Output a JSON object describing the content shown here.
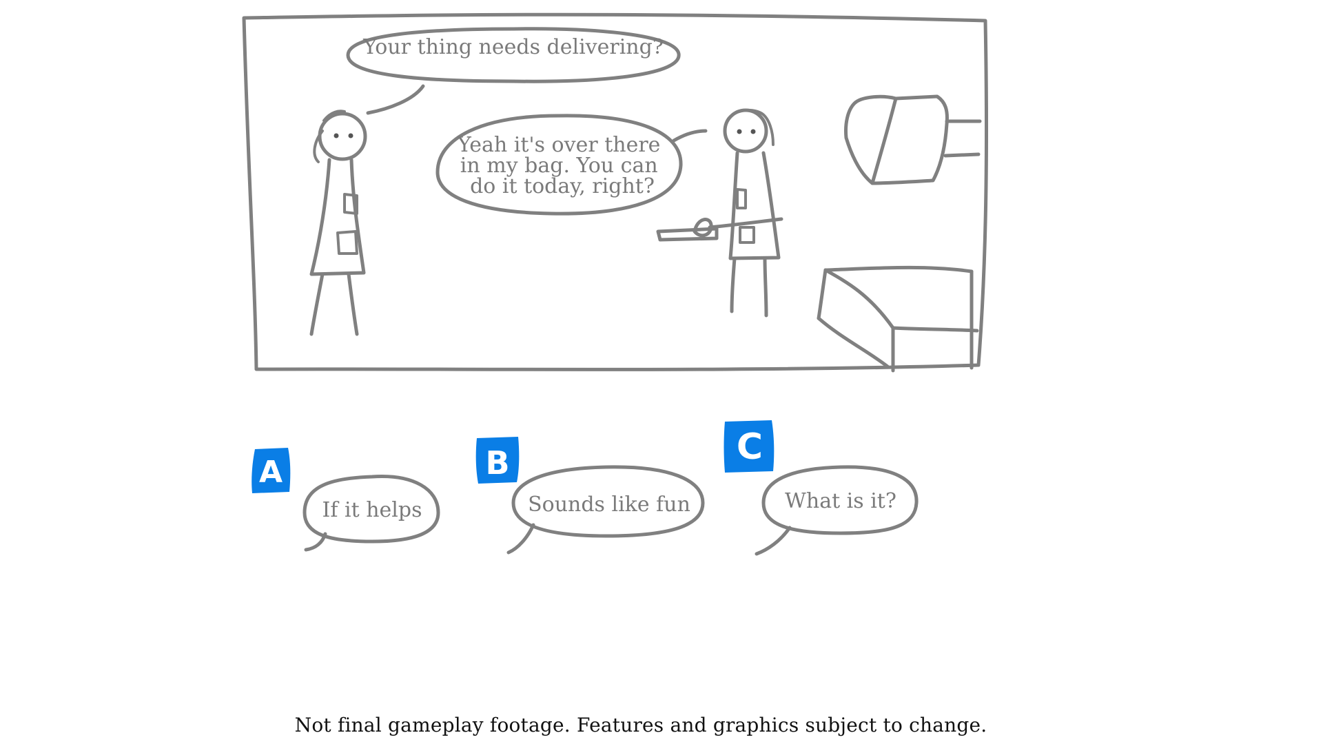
{
  "dialogue": {
    "npc_line": "Your thing needs delivering?",
    "player_line": [
      "Yeah it's over there",
      "in my bag. You can",
      "do it today, right?"
    ]
  },
  "choices": [
    {
      "key": "A",
      "text": "If it helps"
    },
    {
      "key": "B",
      "text": "Sounds like fun"
    },
    {
      "key": "C",
      "text": "What is it?"
    }
  ],
  "colors": {
    "key_badge": "#0a7ee6",
    "line_art": "#808080",
    "speech_text": "#7a7a7a"
  },
  "footer": {
    "disclaimer": "Not final gameplay footage. Features and graphics subject to change."
  }
}
